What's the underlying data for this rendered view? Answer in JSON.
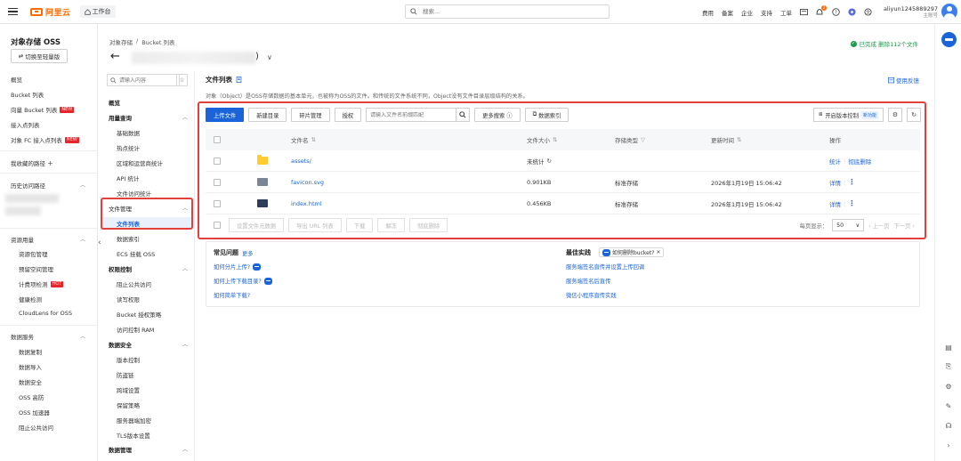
{
  "topbar": {
    "brand": "阿里云",
    "workbench": "工作台",
    "search_placeholder": "搜索...",
    "links": [
      "费用",
      "备案",
      "企业",
      "支持",
      "工单"
    ],
    "bell_count": "2",
    "username": "aliyun1245889297",
    "user_sub": "主账号"
  },
  "sidebar": {
    "title": "对象存储 OSS",
    "switch_label": "切换至轻量版",
    "items": [
      {
        "label": "概览"
      },
      {
        "label": "Bucket 列表"
      },
      {
        "label": "向量 Bucket 列表",
        "badge": "NEW"
      },
      {
        "label": "接入点列表"
      },
      {
        "label": "对象 FC 接入点列表",
        "badge": "NEW"
      }
    ],
    "fav_path": "我收藏的路径",
    "history_path": "历史访问路径",
    "resource_group": "资源用量",
    "resource_items": [
      {
        "label": "资源包管理"
      },
      {
        "label": "预留空间管理"
      },
      {
        "label": "计费项检测",
        "badge": "HOT"
      },
      {
        "label": "健康检测"
      },
      {
        "label": "CloudLens for OSS"
      }
    ],
    "data_group": "数据服务",
    "data_items": [
      {
        "label": "数据复制"
      },
      {
        "label": "数据导入"
      },
      {
        "label": "数据安全"
      },
      {
        "label": "OSS 高防"
      },
      {
        "label": "OSS 加速器"
      },
      {
        "label": "阻止公共访问"
      }
    ]
  },
  "breadcrumb": [
    "对象存储",
    "/",
    "Bucket 列表"
  ],
  "bucket": {
    "suffix": ")"
  },
  "status": "已完成 删除112个文件",
  "inner_nav": {
    "search_placeholder": "请输入内容",
    "overview": "概览",
    "usage_group": "用量查询",
    "usage_items": [
      "基础数据",
      "热点统计",
      "区域和运营商统计",
      "API 统计",
      "文件访问统计"
    ],
    "file_group": "文件管理",
    "file_items": [
      "文件列表",
      "数据索引",
      "ECS 挂载 OSS"
    ],
    "perm_group": "权限控制",
    "perm_items": [
      "阻止公共访问",
      "读写权限",
      "Bucket 授权策略",
      "访问控制 RAM"
    ],
    "sec_group": "数据安全",
    "sec_items": [
      "版本控制",
      "防盗链",
      "跨域设置",
      "保留策略",
      "服务器端加密",
      "TLS版本设置"
    ],
    "mgmt_group": "数据管理"
  },
  "main": {
    "title": "文件列表",
    "feedback": "使用反馈",
    "description": "对象（Object）是OSS存储数据的基本单元，也被称为OSS的文件。和传统的文件系统不同，Object没有文件目录层级结构的关系。",
    "toolbar": {
      "upload": "上传文件",
      "new_dir": "新建目录",
      "fragments": "碎片管理",
      "authorize": "授权",
      "file_search_placeholder": "请输入文件名前缀匹配",
      "more_search": "更多搜索",
      "data_index": "数据索引",
      "version": "开启版本控制",
      "version_tag": "新功能"
    },
    "columns": {
      "name": "文件名",
      "size": "文件大小",
      "storage": "存储类型",
      "updated": "更新时间",
      "actions": "操作"
    },
    "rows": [
      {
        "name": "assets/",
        "size": "未统计",
        "storage": "",
        "updated": "",
        "a1": "统计",
        "a2": "彻底删除",
        "type": "folder"
      },
      {
        "name": "favicon.svg",
        "size": "0.901KB",
        "storage": "标准存储",
        "updated": "2026年1月19日 15:06:42",
        "a1": "详情",
        "a2": "⋮",
        "type": "file"
      },
      {
        "name": "index.html",
        "size": "0.456KB",
        "storage": "标准存储",
        "updated": "2026年1月19日 15:06:42",
        "a1": "详情",
        "a2": "⋮",
        "type": "file"
      }
    ],
    "footer_buttons": [
      "设置文件元数据",
      "导出 URL 列表",
      "下载",
      "解冻",
      "彻底删除"
    ],
    "pager": {
      "per_page_label": "每页显示：",
      "per_page": "50",
      "prev": "上一页",
      "next": "下一页"
    }
  },
  "faq": {
    "title": "常见问题",
    "more": "更多",
    "items": [
      "如何分片上传?",
      "如何上传下载目录?",
      "如何简单下载?"
    ],
    "best_title": "最佳实践",
    "chip": "如何删除bucket?",
    "best_items": [
      "服务端签名直传并设置上传回调",
      "服务端签名后直传",
      "微信小程序直传实践"
    ]
  }
}
